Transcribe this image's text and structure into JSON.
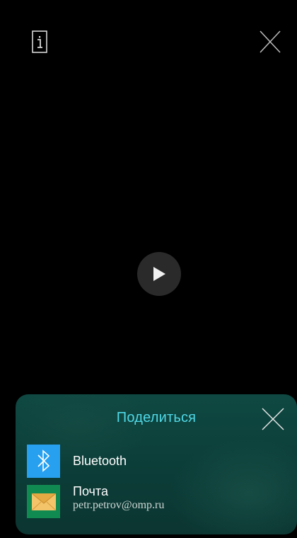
{
  "overlay": {
    "info_icon": "info-icon",
    "close_icon": "close-icon",
    "play_icon": "play-icon"
  },
  "share_sheet": {
    "title": "Поделиться",
    "close_icon": "close-icon",
    "items": [
      {
        "label": "Bluetooth",
        "icon": "bluetooth-icon",
        "icon_color": "#27a0f0"
      },
      {
        "label": "Почта",
        "subtitle": "petr.petrov@omp.ru",
        "icon": "mail-icon",
        "icon_color": "#118a52"
      }
    ]
  },
  "colors": {
    "accent": "#4fd8e6",
    "sheet_background": "#0f4842",
    "screen_background": "#000000"
  }
}
